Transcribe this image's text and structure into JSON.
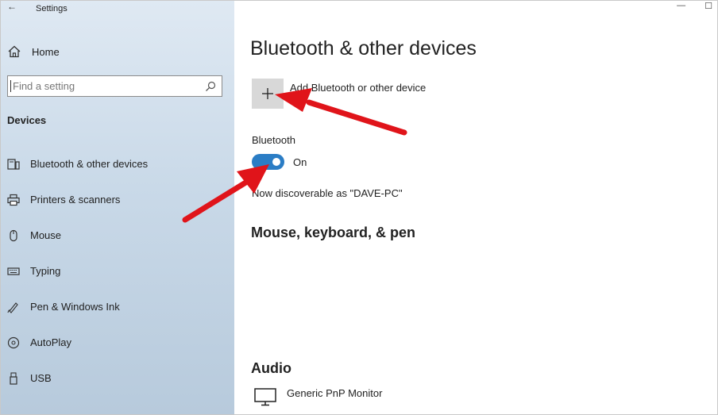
{
  "window": {
    "app_title": "Settings",
    "back_icon": "back-arrow-icon",
    "controls": [
      "—",
      "☐"
    ]
  },
  "sidebar": {
    "home_label": "Home",
    "search_placeholder": "Find a setting",
    "section_label": "Devices",
    "items": [
      {
        "label": "Bluetooth & other devices",
        "icon": "bluetooth-devices-icon"
      },
      {
        "label": "Printers & scanners",
        "icon": "printer-icon"
      },
      {
        "label": "Mouse",
        "icon": "mouse-icon"
      },
      {
        "label": "Typing",
        "icon": "keyboard-icon"
      },
      {
        "label": "Pen & Windows Ink",
        "icon": "pen-icon"
      },
      {
        "label": "AutoPlay",
        "icon": "autoplay-icon"
      },
      {
        "label": "USB",
        "icon": "usb-icon"
      }
    ]
  },
  "main": {
    "page_title": "Bluetooth & other devices",
    "add_device_label": "Add Bluetooth or other device",
    "add_icon": "plus-icon",
    "bluetooth_label": "Bluetooth",
    "toggle_state": "On",
    "discoverable_text": "Now discoverable as \"DAVE-PC\"",
    "mouse_heading": "Mouse, keyboard, & pen",
    "audio_heading": "Audio",
    "audio_device": "Generic PnP Monitor"
  },
  "colors": {
    "accent": "#2b7dc5",
    "annotation_arrow": "#e0141a",
    "sidebar_top": "#dfe9f3",
    "sidebar_bottom": "#b7cadc"
  }
}
